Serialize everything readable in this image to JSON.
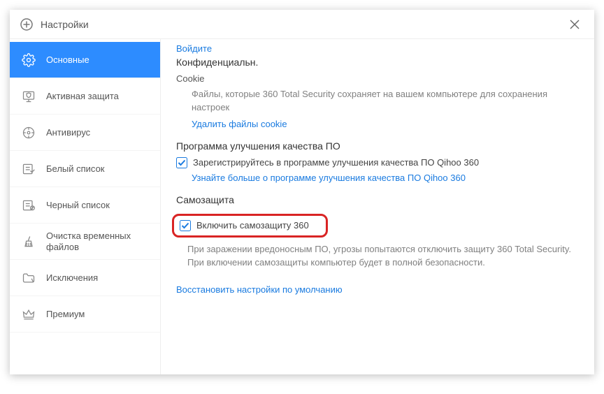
{
  "window": {
    "title": "Настройки"
  },
  "sidebar": {
    "items": [
      {
        "label": "Основные"
      },
      {
        "label": "Активная защита"
      },
      {
        "label": "Антивирус"
      },
      {
        "label": "Белый список"
      },
      {
        "label": "Черный список"
      },
      {
        "label": "Очистка временных файлов"
      },
      {
        "label": "Исключения"
      },
      {
        "label": "Премиум"
      }
    ]
  },
  "content": {
    "login_link": "Войдите",
    "privacy_heading": "Конфиденциальн.",
    "cookie_heading": "Cookie",
    "cookie_desc": "Файлы, которые 360 Total Security сохраняет на вашем компьютере для сохранения настроек",
    "cookie_link": "Удалить файлы cookie",
    "improve_heading": "Программа улучшения качества ПО",
    "improve_checkbox": "Зарегистрируйтесь в программе улучшения качества ПО Qihoo 360",
    "improve_link": "Узнайте больше о программе улучшения качества ПО Qihoo 360",
    "selfprotect_heading": "Самозащита",
    "selfprotect_checkbox": "Включить самозащиту 360",
    "selfprotect_desc": "При заражении вредоносным ПО, угрозы попытаются отключить защиту 360 Total Security. При включении самозащиты компьютер будет в полной безопасности.",
    "restore_link": "Восстановить настройки по умолчанию"
  }
}
